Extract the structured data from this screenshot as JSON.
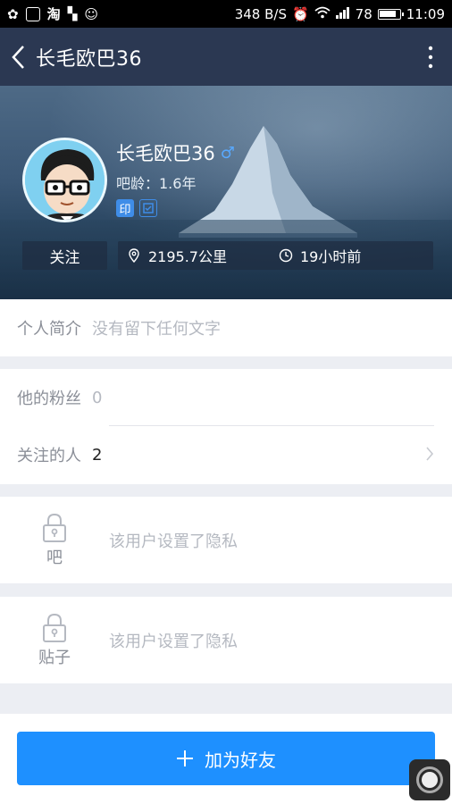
{
  "status_bar": {
    "net_speed": "348 B/S",
    "battery": "78",
    "time": "11:09"
  },
  "app_bar": {
    "title": "长毛欧巴36"
  },
  "profile": {
    "name": "长毛欧巴36",
    "gender_icon": "♂",
    "age_text": "吧龄：1.6年",
    "badge_label": "印",
    "follow_label": "关注",
    "distance": "2195.7公里",
    "last_active": "19小时前"
  },
  "sections": {
    "intro": {
      "label": "个人简介",
      "value": "没有留下任何文字"
    },
    "fans": {
      "label": "他的粉丝",
      "value": "0"
    },
    "following": {
      "label": "关注的人",
      "value": "2"
    },
    "bars": {
      "label": "吧",
      "value": "该用户设置了隐私"
    },
    "posts": {
      "label": "贴子",
      "value": "该用户设置了隐私"
    }
  },
  "actions": {
    "add_friend_label": "加为好友",
    "add_icon": "plus-icon"
  },
  "colors": {
    "app_bar": "#2b3852",
    "primary": "#1e90ff",
    "badge": "#3f8de8"
  }
}
